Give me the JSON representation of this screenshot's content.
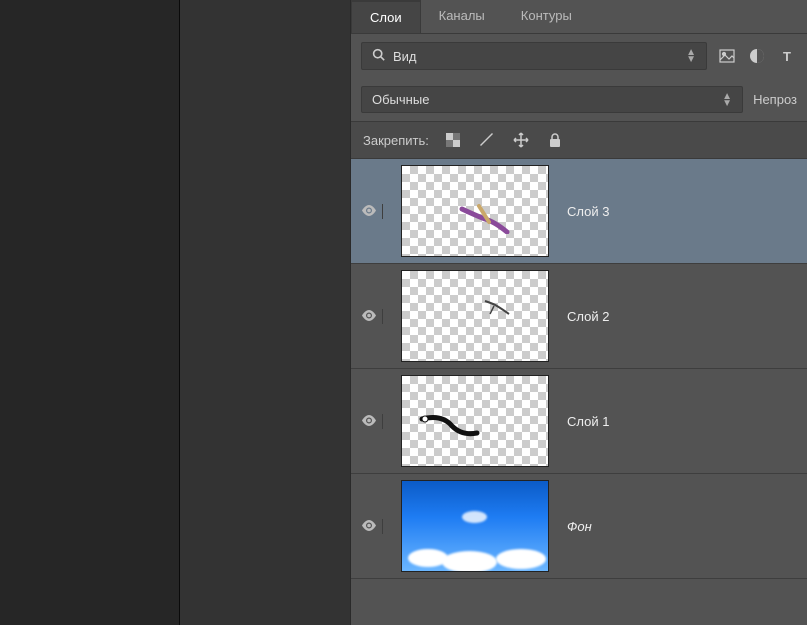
{
  "tabs": {
    "layers": "Слои",
    "channels": "Каналы",
    "paths": "Контуры"
  },
  "filter": {
    "label": "Вид"
  },
  "blend_mode": {
    "value": "Обычные"
  },
  "opacity_label": "Непроз",
  "lock": {
    "label": "Закрепить:"
  },
  "layers_list": [
    {
      "name": "Слой 3",
      "type": "transparent",
      "selected": true
    },
    {
      "name": "Слой 2",
      "type": "transparent",
      "selected": false
    },
    {
      "name": "Слой 1",
      "type": "transparent",
      "selected": false
    },
    {
      "name": "Фон",
      "type": "background",
      "selected": false
    }
  ]
}
